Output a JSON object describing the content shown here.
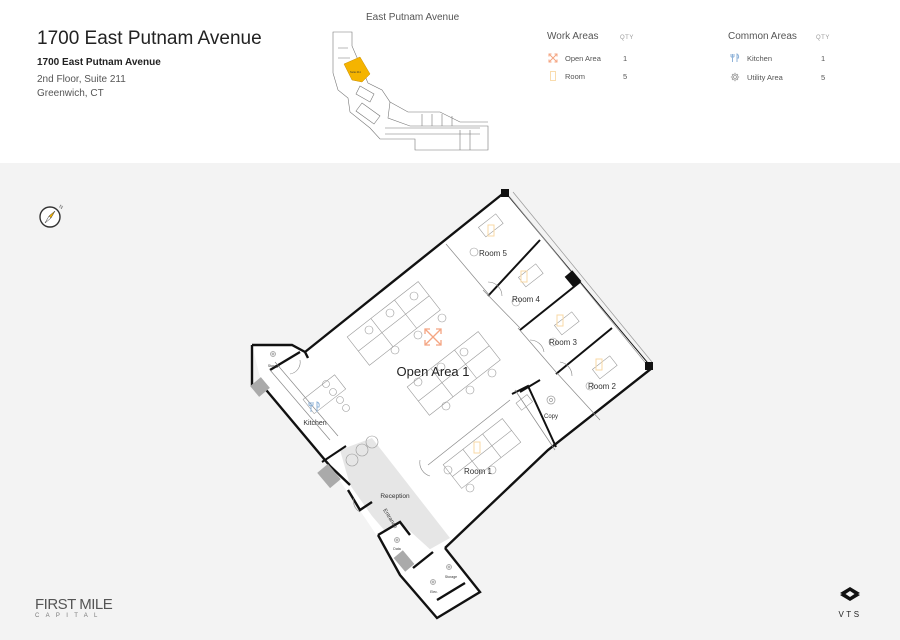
{
  "header": {
    "title": "1700 East Putnam Avenue",
    "address_bold": "1700 East Putnam Avenue",
    "floor_suite": "2nd Floor, Suite 211",
    "city": "Greenwich, CT"
  },
  "keyplan": {
    "street_label": "East Putnam Avenue",
    "suite_highlight_label": "Suite 211",
    "highlight_color": "#f5b400"
  },
  "legend": {
    "work_areas": {
      "heading": "Work Areas",
      "qty_label": "QTY",
      "items": [
        {
          "icon": "expand-arrows-icon",
          "label": "Open Area",
          "qty": "1",
          "color": "#f4a582"
        },
        {
          "icon": "door-rectangle-icon",
          "label": "Room",
          "qty": "5",
          "color": "#f9d9a6"
        }
      ]
    },
    "common_areas": {
      "heading": "Common Areas",
      "qty_label": "QTY",
      "items": [
        {
          "icon": "fork-knife-icon",
          "label": "Kitchen",
          "qty": "1",
          "color": "#8fb3d9"
        },
        {
          "icon": "gear-icon",
          "label": "Utility Area",
          "qty": "5",
          "color": "#999999"
        }
      ]
    }
  },
  "floorplan": {
    "rooms": {
      "open_area": "Open Area 1",
      "room1": "Room 1",
      "room2": "Room 2",
      "room3": "Room 3",
      "room4": "Room 4",
      "room5": "Room 5",
      "kitchen": "Kitchen",
      "copy": "Copy",
      "reception": "Reception",
      "entrance": "Entrance",
      "storage_left": "Storage",
      "storage_bottom": "Storage",
      "elec": "Elec.",
      "data": "Data"
    },
    "compass_label": "N"
  },
  "branding": {
    "left_logo_main": "FIRST MILE",
    "left_logo_sub": "CAPITAL",
    "right_logo": "VTS"
  },
  "colors": {
    "open_area_accent": "#f4a582",
    "room_accent": "#f9d9a6",
    "kitchen_accent": "#8fb3d9",
    "reception_fill": "#e6e6e6",
    "page_background": "#f3f3f3"
  }
}
